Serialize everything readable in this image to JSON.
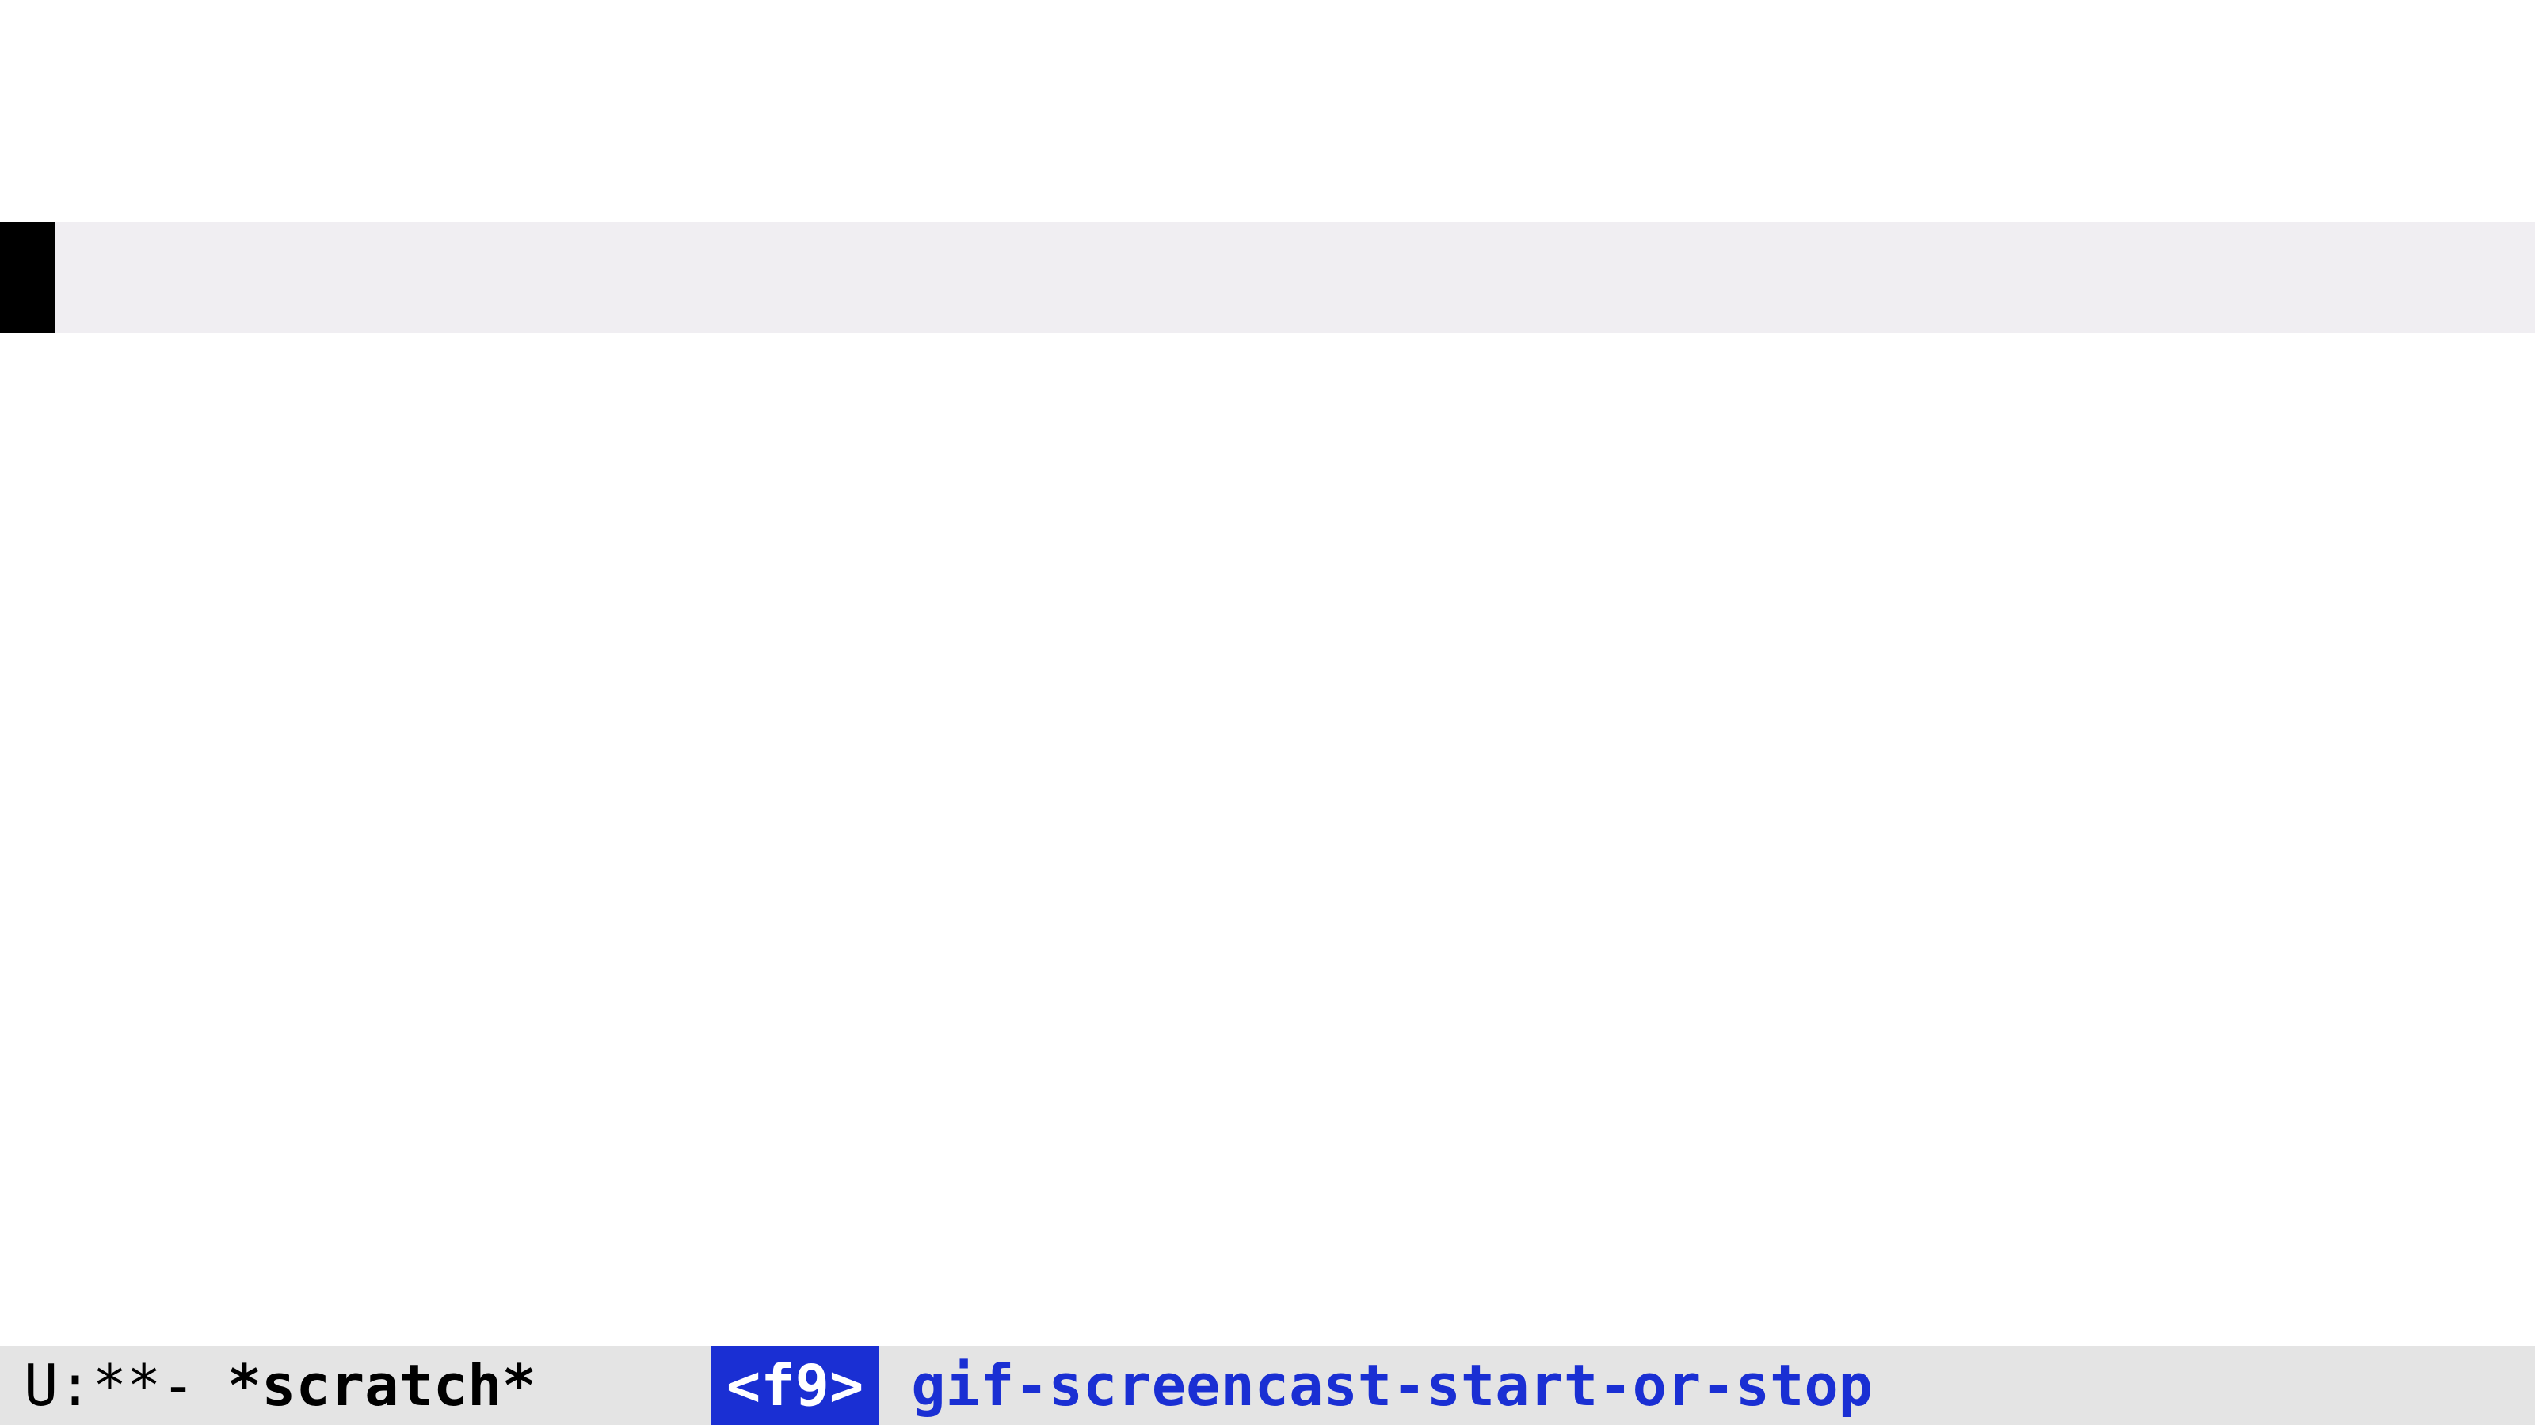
{
  "editor": {
    "buffer_content": ""
  },
  "mode_line": {
    "status": "U:**-",
    "buffer_name": "*scratch*",
    "key_binding": "<f9>",
    "command": "gif-screencast-start-or-stop"
  }
}
